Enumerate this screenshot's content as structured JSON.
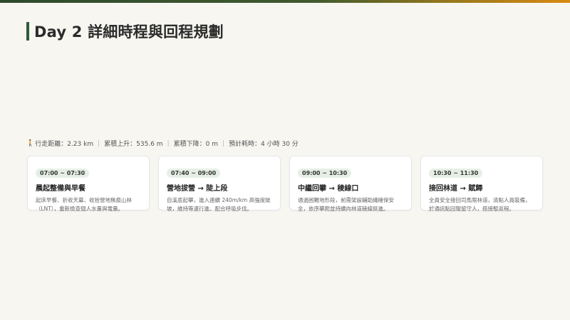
{
  "header": {
    "title": "Day 2 詳細時程與回程規劃"
  },
  "stats": {
    "icon": "walking-person-icon",
    "distance": "行走距離：2.23 km",
    "ascent": "累積上升：535.6 m",
    "descent": "累積下降：0 m",
    "duration": "預計耗時：4 小時 30 分",
    "separator": "|"
  },
  "cards": [
    {
      "time": "07:00 ~ 07:30",
      "title": "晨起整備與早餐",
      "desc": "起床早餐、折收天幕、收拾營地無痕山林（LNT），重新檢查個人水量與電量。"
    },
    {
      "time": "07:40 ~ 09:00",
      "title": "營地拔營 → 陡上段",
      "desc": "自溪底起攀，進入連續 240m/km 高強度陡坡，維持等速行進、配合呼吸步伐。"
    },
    {
      "time": "09:00 ~ 10:30",
      "title": "中繼回攀 → 稜線口",
      "desc": "通過困難地形段，前需架設輔助繩確保安全，依序攀爬並持續向林道稜線挺進。"
    },
    {
      "time": "10:30 ~ 11:30",
      "title": "接回林道 → 賦歸",
      "desc": "全員安全接回司馬限林道，清點人員裝備，於通訊點回報留守人，搭接駁返程。"
    }
  ],
  "colors": {
    "accent": "#2f5a3a",
    "badge_bg": "#e6efe6",
    "background": "#f7f6f1"
  }
}
